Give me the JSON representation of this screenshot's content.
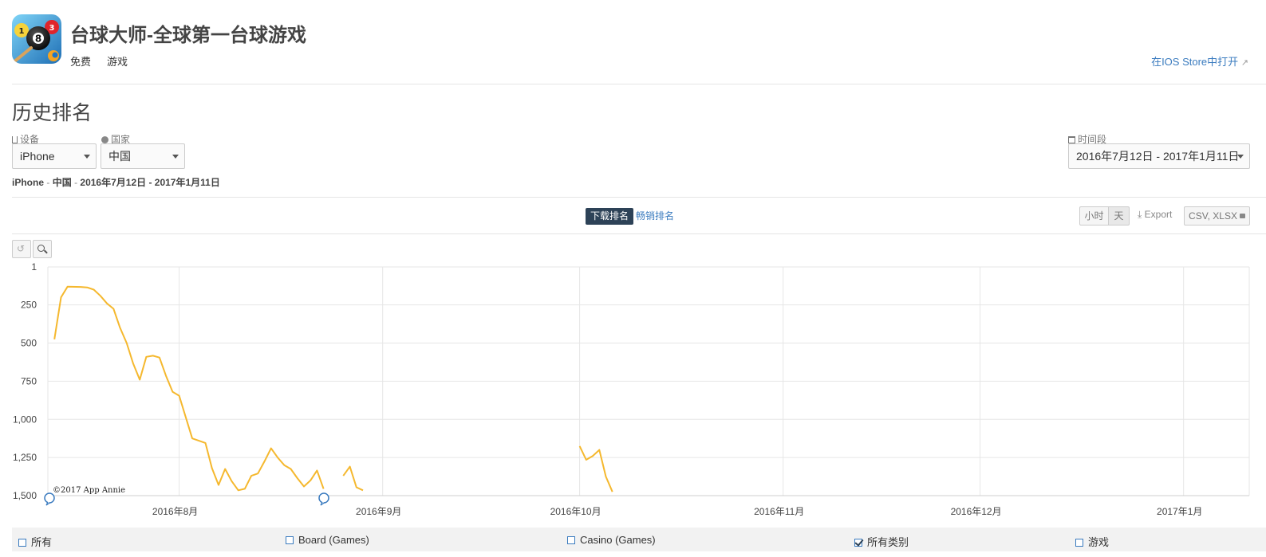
{
  "app": {
    "title": "台球大师-全球第一台球游戏",
    "price": "免费",
    "category": "游戏",
    "store_link": "在IOS Store中打开"
  },
  "section": {
    "title": "历史排名"
  },
  "filters": {
    "device_label": "设备",
    "device_value": "iPhone",
    "country_label": "国家",
    "country_value": "中国",
    "period_label": "时间段",
    "period_value": "2016年7月12日 - 2017年1月11日"
  },
  "summary": {
    "device": "iPhone",
    "country": "中国",
    "range": "2016年7月12日 - 2017年1月11日"
  },
  "tabs": {
    "download": "下载排名",
    "grossing": "畅销排名"
  },
  "controls": {
    "hour": "小时",
    "day": "天",
    "export": "Export",
    "formats": "CSV, XLSX"
  },
  "chart_data": {
    "type": "line",
    "y_axis": {
      "ticks": [
        1,
        250,
        500,
        750,
        1000,
        1250,
        1500
      ],
      "tick_labels": [
        "1",
        "250",
        "500",
        "750",
        "1,000",
        "1,250",
        "1,500"
      ],
      "reversed": true,
      "ylim": [
        1,
        1500
      ]
    },
    "x_axis": {
      "tick_labels": [
        "2016年8月",
        "2016年9月",
        "2016年10月",
        "2016年11月",
        "2016年12月",
        "2017年1月"
      ],
      "xlim": [
        "2016-07-12",
        "2017-01-11"
      ]
    },
    "grid": true,
    "color": "#f5b82e",
    "watermark": "©2017 App Annie",
    "series": [
      {
        "segments": [
          [
            [
              "2016-07-13",
              475
            ],
            [
              "2016-07-14",
              200
            ],
            [
              "2016-07-15",
              130
            ],
            [
              "2016-07-17",
              132
            ],
            [
              "2016-07-18",
              135
            ],
            [
              "2016-07-19",
              150
            ],
            [
              "2016-07-20",
              190
            ],
            [
              "2016-07-21",
              240
            ],
            [
              "2016-07-22",
              275
            ],
            [
              "2016-07-23",
              400
            ],
            [
              "2016-07-24",
              500
            ],
            [
              "2016-07-25",
              635
            ],
            [
              "2016-07-26",
              740
            ],
            [
              "2016-07-27",
              590
            ],
            [
              "2016-07-28",
              583
            ],
            [
              "2016-07-29",
              595
            ],
            [
              "2016-07-30",
              715
            ],
            [
              "2016-07-31",
              820
            ],
            [
              "2016-08-01",
              845
            ],
            [
              "2016-08-02",
              985
            ],
            [
              "2016-08-03",
              1125
            ],
            [
              "2016-08-04",
              1140
            ],
            [
              "2016-08-05",
              1155
            ],
            [
              "2016-08-06",
              1320
            ],
            [
              "2016-08-07",
              1430
            ],
            [
              "2016-08-08",
              1325
            ],
            [
              "2016-08-09",
              1405
            ],
            [
              "2016-08-10",
              1465
            ],
            [
              "2016-08-11",
              1455
            ],
            [
              "2016-08-12",
              1370
            ],
            [
              "2016-08-13",
              1355
            ],
            [
              "2016-08-14",
              1275
            ],
            [
              "2016-08-15",
              1190
            ],
            [
              "2016-08-16",
              1250
            ],
            [
              "2016-08-17",
              1300
            ],
            [
              "2016-08-18",
              1325
            ],
            [
              "2016-08-19",
              1385
            ],
            [
              "2016-08-20",
              1440
            ],
            [
              "2016-08-21",
              1400
            ],
            [
              "2016-08-22",
              1335
            ],
            [
              "2016-08-23",
              1455
            ]
          ],
          [
            [
              "2016-08-26",
              1370
            ],
            [
              "2016-08-27",
              1310
            ],
            [
              "2016-08-28",
              1445
            ],
            [
              "2016-08-29",
              1465
            ]
          ],
          [
            [
              "2016-10-01",
              1175
            ],
            [
              "2016-10-02",
              1265
            ],
            [
              "2016-10-03",
              1240
            ],
            [
              "2016-10-04",
              1200
            ],
            [
              "2016-10-05",
              1375
            ],
            [
              "2016-10-06",
              1475
            ]
          ]
        ]
      }
    ]
  },
  "legend": {
    "items": [
      {
        "label": "所有",
        "checked": false
      },
      {
        "label": "Board (Games)",
        "checked": false
      },
      {
        "label": "Casino (Games)",
        "checked": false
      },
      {
        "label": "所有类别",
        "checked": true
      },
      {
        "label": "游戏",
        "checked": false
      }
    ]
  }
}
